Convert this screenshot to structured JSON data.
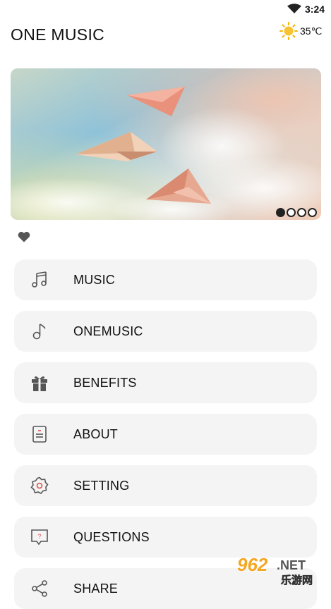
{
  "status_bar": {
    "time": "3:24",
    "wifi_icon": "wifi-icon"
  },
  "header": {
    "title": "ONE MUSIC",
    "weather_icon": "sun-icon",
    "temperature": "35℃"
  },
  "banner": {
    "image": "paper-airplanes-in-sky",
    "page_count": 4,
    "active_page": 1
  },
  "favorite_icon": "heart-icon",
  "menu": [
    {
      "label": "MUSIC",
      "icon": "music-notes-icon"
    },
    {
      "label": "ONEMUSIC",
      "icon": "music-note-icon"
    },
    {
      "label": "BENEFITS",
      "icon": "gift-icon"
    },
    {
      "label": "ABOUT",
      "icon": "document-icon"
    },
    {
      "label": "SETTING",
      "icon": "gear-icon"
    },
    {
      "label": "QUESTIONS",
      "icon": "question-bubble-icon"
    },
    {
      "label": "SHARE",
      "icon": "share-icon"
    }
  ],
  "watermark": {
    "brand": "962.NET",
    "sub": "乐游网"
  },
  "colors": {
    "menu_background": "#f4f4f4",
    "text": "#111111",
    "watermark_accent": "#f5a623"
  }
}
